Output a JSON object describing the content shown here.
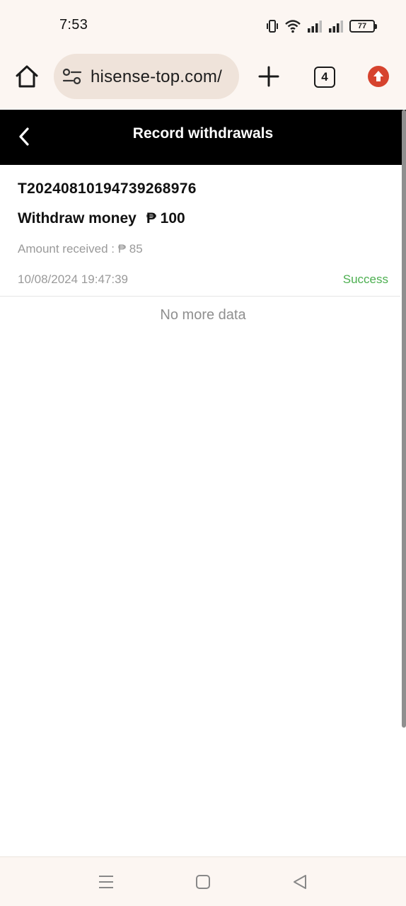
{
  "status_bar": {
    "time": "7:53",
    "battery": "77",
    "icons": [
      "vibrate-icon",
      "wifi-icon",
      "signal-icon",
      "signal-icon",
      "battery-icon"
    ]
  },
  "browser": {
    "url": "hisense-top.com/",
    "tab_count": "4",
    "icons": [
      "home-icon",
      "tune-icon",
      "plus-icon",
      "tabs-icon",
      "update-arrow-icon"
    ],
    "update_color": "#d6432e"
  },
  "header": {
    "title": "Record withdrawals",
    "back_icon": "chevron-left-icon"
  },
  "records": [
    {
      "order_id": "T20240810194739268976",
      "withdraw_label": "Withdraw money",
      "withdraw_amount": "₱ 100",
      "received_text": "Amount received : ₱ 85",
      "datetime": "10/08/2024 19:47:39",
      "status": "Success",
      "status_color": "#4caf50"
    }
  ],
  "list_footer": "No more data",
  "nav_bar": {
    "icons": [
      "menu-icon",
      "square-home-icon",
      "triangle-back-icon"
    ]
  }
}
